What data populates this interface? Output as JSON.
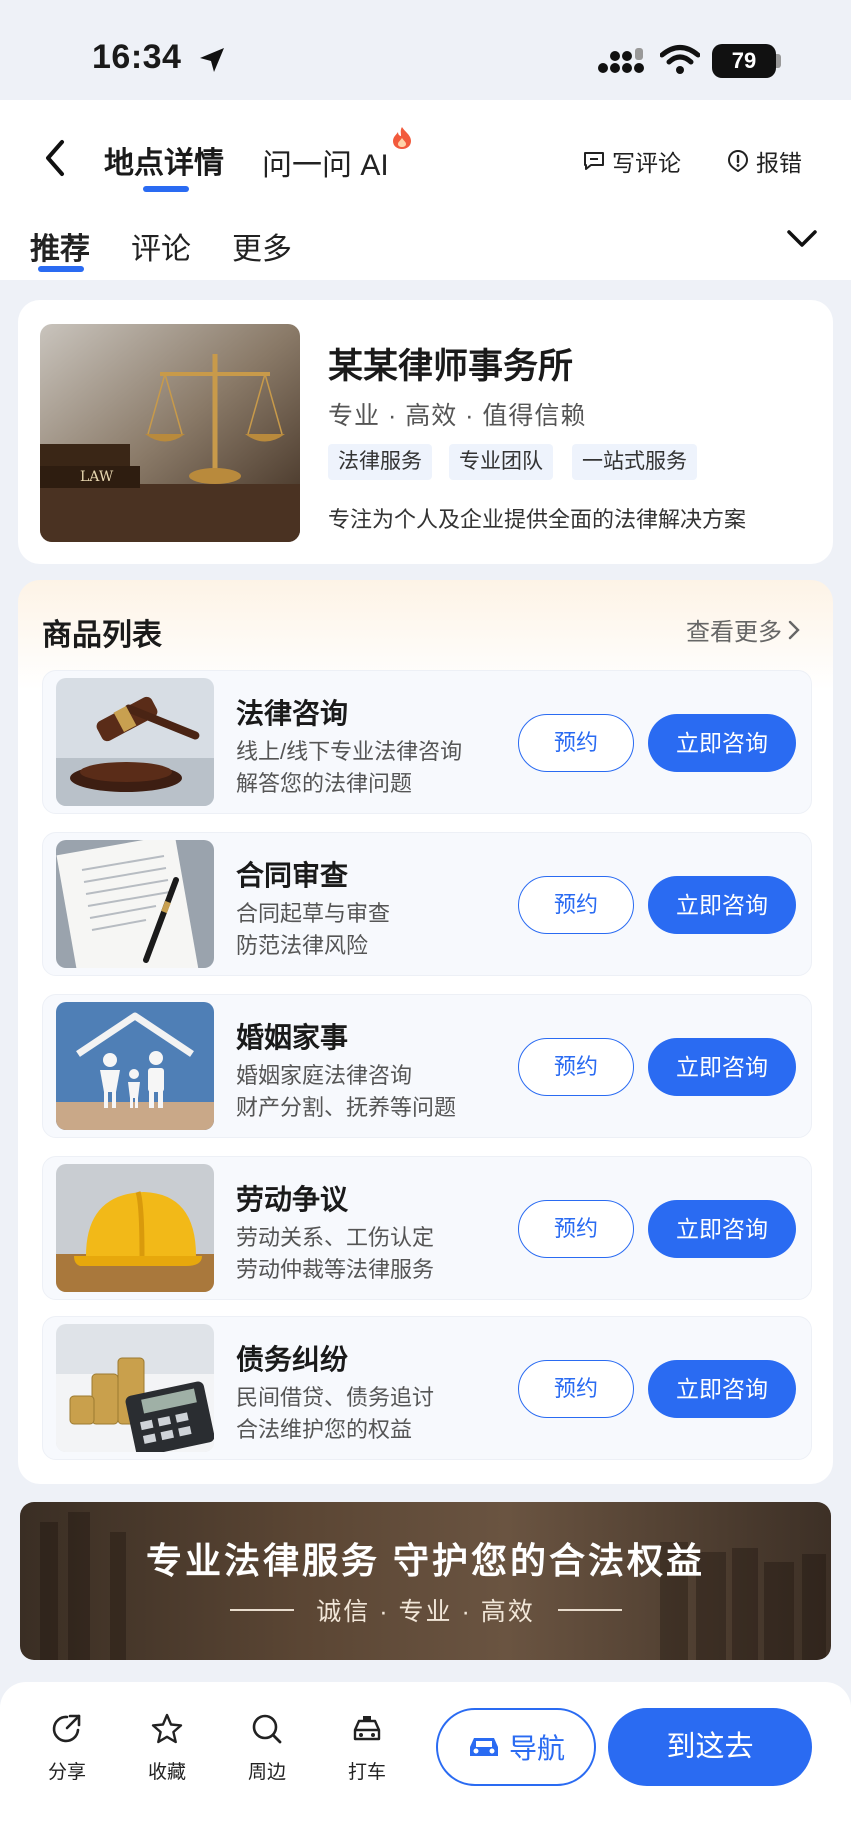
{
  "status_bar": {
    "time": "16:34",
    "battery": "79"
  },
  "header": {
    "back_icon": "chevron-left-icon",
    "tabs": [
      {
        "label": "地点详情",
        "active": true
      },
      {
        "label": "问一问 AI",
        "active": false
      }
    ],
    "actions": [
      {
        "label": "写评论",
        "icon": "comment-icon"
      },
      {
        "label": "报错",
        "icon": "alert-icon"
      }
    ],
    "sub_tabs": [
      {
        "label": "推荐",
        "active": true
      },
      {
        "label": "评论"
      },
      {
        "label": "更多"
      }
    ]
  },
  "business": {
    "name": "某某律师事务所",
    "slogan": "专业 · 高效 · 值得信赖",
    "tags": [
      "法律服务",
      "专业团队",
      "一站式服务"
    ],
    "description": "专注为个人及企业提供全面的法律解决方案",
    "image_text": "LAW"
  },
  "products": {
    "title": "商品列表",
    "see_more": "查看更多",
    "book_label": "预约",
    "consult_label": "立即咨询",
    "items": [
      {
        "name": "法律咨询",
        "desc1": "线上/线下专业法律咨询",
        "desc2": "解答您的法律问题"
      },
      {
        "name": "合同审查",
        "desc1": "合同起草与审查",
        "desc2": "防范法律风险"
      },
      {
        "name": "婚姻家事",
        "desc1": "婚姻家庭法律咨询",
        "desc2": "财产分割、抚养等问题"
      },
      {
        "name": "劳动争议",
        "desc1": "劳动关系、工伤认定",
        "desc2": "劳动仲裁等法律服务"
      },
      {
        "name": "债务纠纷",
        "desc1": "民间借贷、债务追讨",
        "desc2": "合法维护您的权益"
      }
    ]
  },
  "banner": {
    "main": "专业法律服务  守护您的合法权益",
    "sub": "诚信 · 专业 · 高效"
  },
  "bottom_bar": {
    "items": [
      {
        "label": "分享",
        "icon": "share-icon"
      },
      {
        "label": "收藏",
        "icon": "star-icon"
      },
      {
        "label": "周边",
        "icon": "search-icon"
      },
      {
        "label": "打车",
        "icon": "taxi-icon"
      }
    ],
    "navigate": "导航",
    "go": "到这去"
  },
  "colors": {
    "accent": "#2a6bf2",
    "background": "#eef1f7"
  }
}
